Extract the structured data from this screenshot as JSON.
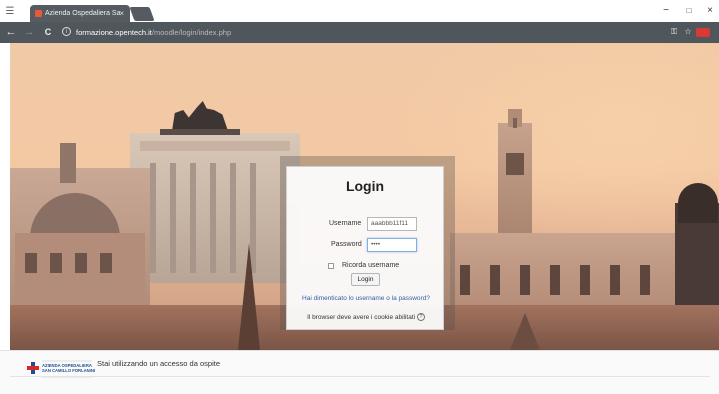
{
  "browser": {
    "tab_title": "Azienda Ospedaliera Sa",
    "tab_close": "×",
    "url_host": "formazione.opentech.it",
    "url_path": "/moodle/login/index.php",
    "window_controls": {
      "minimize": "−",
      "maximize": "□",
      "close": "×"
    },
    "nav": {
      "back": "←",
      "forward": "→",
      "reload": "C"
    }
  },
  "login": {
    "title": "Login",
    "username_label": "Username",
    "username_value": "aaabbb11f11",
    "password_label": "Password",
    "password_value": "••••",
    "remember_label": "Ricorda username",
    "remember_checked": false,
    "login_button": "Login",
    "forgot_link": "Hai dimenticato lo username o la password?",
    "cookies_notice": "Il browser deve avere i cookie abilitati"
  },
  "footer": {
    "logo_title_1": "AZIENDA OSPEDALIERA",
    "logo_title_2": "SAN CAMILLO FORLANINI",
    "guest_text": "Stai utilizzando un accesso da ospite"
  },
  "colors": {
    "accent_link": "#2d5ea7",
    "chrome_dark": "#50575c",
    "logo_red": "#d6262b",
    "logo_blue": "#1d4f91"
  }
}
